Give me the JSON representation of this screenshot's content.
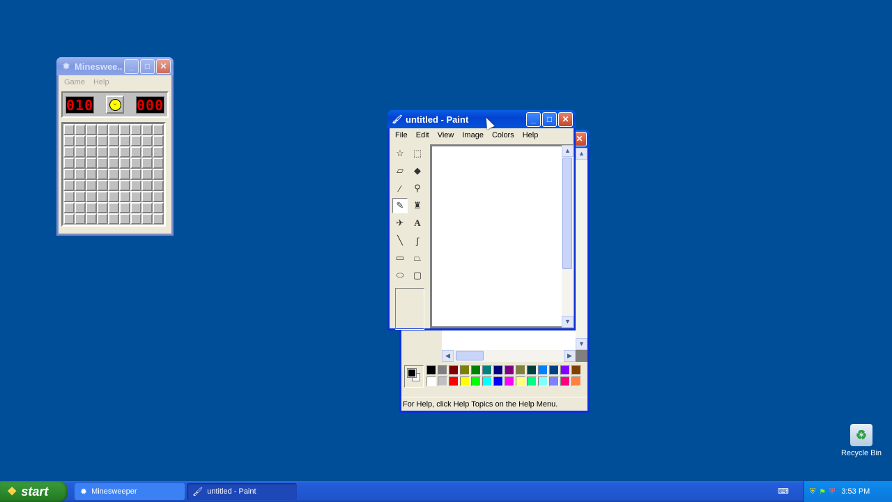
{
  "minesweeper": {
    "title": "Minesweeper",
    "title_truncated": "Mineswee...",
    "menu": [
      "Game",
      "Help"
    ],
    "mines_left": "010",
    "timer": "000",
    "rows": 9,
    "cols": 9
  },
  "paint": {
    "title": "untitled - Paint",
    "menu": [
      "File",
      "Edit",
      "View",
      "Image",
      "Colors",
      "Help"
    ],
    "status_text": "For Help, click Help Topics on the Help Menu.",
    "selected_tool": "pencil",
    "tools": [
      "free-form-select",
      "select",
      "eraser",
      "fill-with-color",
      "pick-color",
      "magnifier",
      "pencil",
      "brush",
      "airbrush",
      "text",
      "line",
      "curve",
      "rectangle",
      "polygon",
      "ellipse",
      "rounded-rectangle"
    ],
    "palette_top": [
      "#000000",
      "#808080",
      "#800000",
      "#808000",
      "#008000",
      "#008080",
      "#000080",
      "#800080",
      "#808040",
      "#004040",
      "#0080FF",
      "#004080",
      "#8000FF",
      "#804000"
    ],
    "palette_bottom": [
      "#FFFFFF",
      "#C0C0C0",
      "#FF0000",
      "#FFFF00",
      "#00FF00",
      "#00FFFF",
      "#0000FF",
      "#FF00FF",
      "#FFFF80",
      "#00FF80",
      "#80FFFF",
      "#8080FF",
      "#FF0080",
      "#FF8040"
    ],
    "foreground": "#000000",
    "background": "#FFFFFF"
  },
  "taskbar": {
    "start_label": "start",
    "tasks": [
      {
        "label": "Minesweeper"
      },
      {
        "label": "untitled - Paint"
      }
    ],
    "clock": "3:53 PM"
  },
  "desktop": {
    "recycle_bin_label": "Recycle Bin"
  }
}
